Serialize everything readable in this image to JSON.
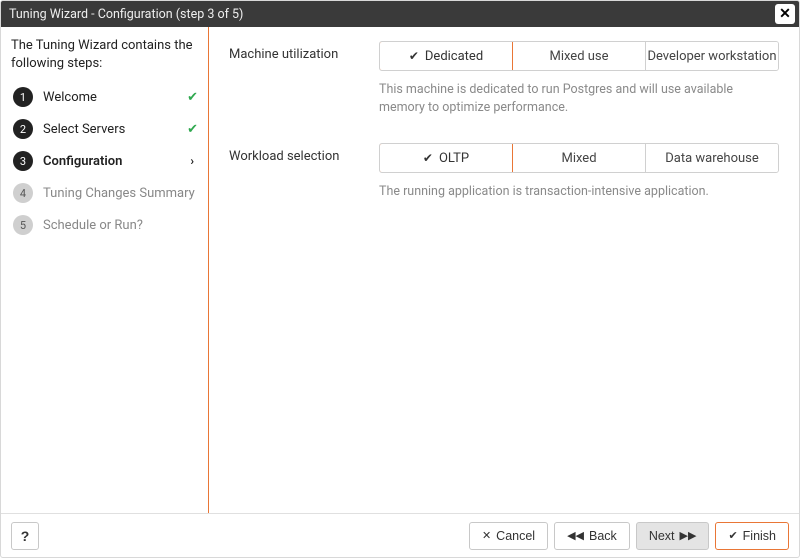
{
  "title": "Tuning Wizard - Configuration (step 3 of 5)",
  "sidebar": {
    "intro": "The Tuning Wizard contains the following steps:",
    "steps": [
      {
        "num": "1",
        "label": "Welcome",
        "state": "done"
      },
      {
        "num": "2",
        "label": "Select Servers",
        "state": "done"
      },
      {
        "num": "3",
        "label": "Configuration",
        "state": "current"
      },
      {
        "num": "4",
        "label": "Tuning Changes Summary",
        "state": "future"
      },
      {
        "num": "5",
        "label": "Schedule or Run?",
        "state": "future"
      }
    ]
  },
  "main": {
    "machine": {
      "label": "Machine utilization",
      "options": [
        "Dedicated",
        "Mixed use",
        "Developer workstation"
      ],
      "selected": 0,
      "helper": "This machine is dedicated to run Postgres and will use available memory to optimize performance."
    },
    "workload": {
      "label": "Workload selection",
      "options": [
        "OLTP",
        "Mixed",
        "Data warehouse"
      ],
      "selected": 0,
      "helper": "The running application is transaction-intensive application."
    }
  },
  "footer": {
    "help": "?",
    "cancel": "Cancel",
    "back": "Back",
    "next": "Next",
    "finish": "Finish"
  }
}
